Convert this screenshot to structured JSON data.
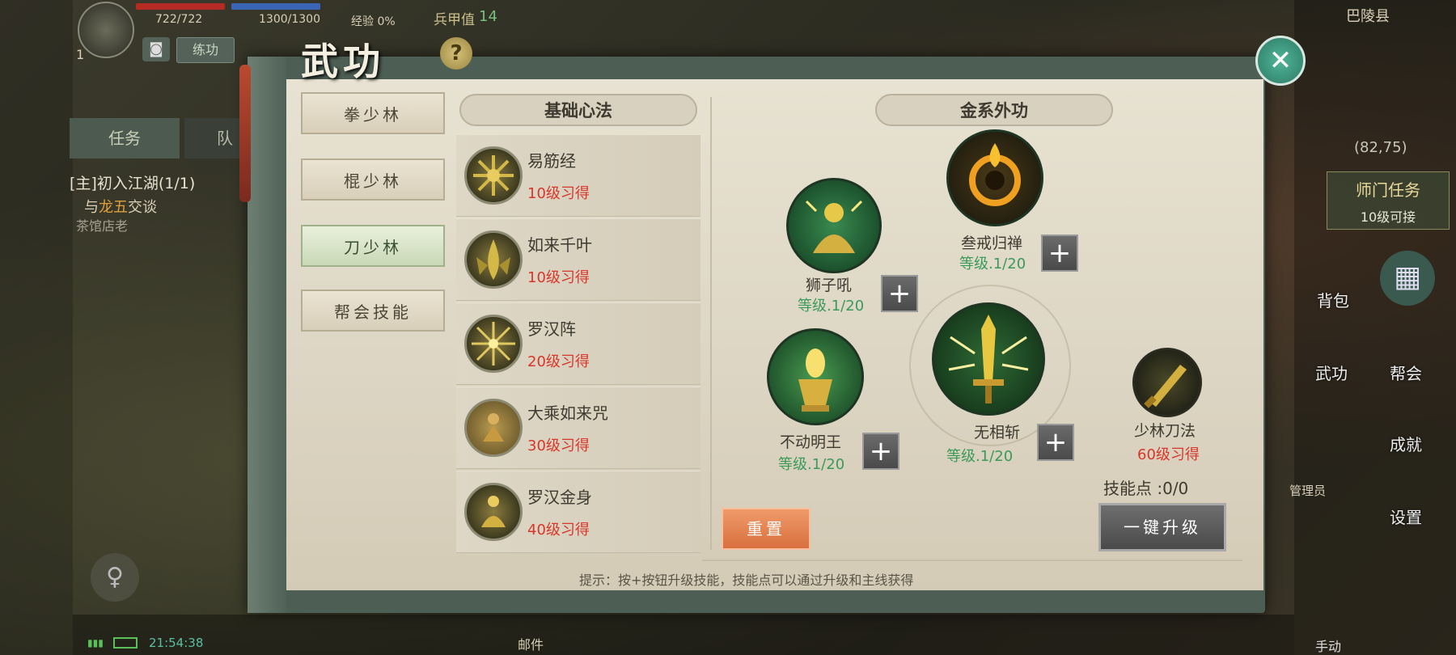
{
  "hud": {
    "hp": "722/722",
    "mp": "1300/1300",
    "exp": "经验 0%",
    "armor_label": "兵甲值",
    "armor_value": "14",
    "level": "1",
    "practice_btn": "练功",
    "task_tab": "任务",
    "team_tab": "队",
    "quest_title": "[主]初入江湖(1/1)",
    "quest_prefix": "与",
    "quest_npc": "龙五",
    "quest_action": "交谈",
    "quest_sub": "茶馆店老",
    "time": "21:54:38",
    "mail": "邮件"
  },
  "right_hud": {
    "location": "巴陵县",
    "coords": "(82,75)",
    "sect_task": "师门任务",
    "sect_task_req": "10级可接",
    "bag": "背包",
    "wugong": "武功",
    "guild": "帮会",
    "achievement": "成就",
    "settings": "设置",
    "admin": "管理员",
    "manual": "手动"
  },
  "modal": {
    "title": "武功",
    "help_symbol": "?",
    "close_symbol": "✕",
    "tabs": [
      {
        "label": "拳少林"
      },
      {
        "label": "棍少林"
      },
      {
        "label": "刀少林"
      },
      {
        "label": "帮会技能"
      }
    ],
    "active_tab": 2,
    "basic_title": "基础心法",
    "basic_list": [
      {
        "name": "易筋经",
        "req": "10级习得",
        "icon": "yijinjing-icon"
      },
      {
        "name": "如来千叶",
        "req": "10级习得",
        "icon": "rulai-qianye-icon"
      },
      {
        "name": "罗汉阵",
        "req": "20级习得",
        "icon": "luohan-zhen-icon"
      },
      {
        "name": "大乘如来咒",
        "req": "30级习得",
        "icon": "dacheng-icon"
      },
      {
        "name": "罗汉金身",
        "req": "40级习得",
        "icon": "luohan-jinshen-icon"
      }
    ],
    "ext_title": "金系外功",
    "skills": {
      "shizi": {
        "name": "狮子吼",
        "lv": "等级.1/20"
      },
      "sanjie": {
        "name": "叁戒归禅",
        "lv": "等级.1/20"
      },
      "budong": {
        "name": "不动明王",
        "lv": "等级.1/20"
      },
      "wuxiang": {
        "name": "无相斩",
        "lv": "等级.1/20"
      },
      "shaolin_dao": {
        "name": "少林刀法",
        "req": "60级习得"
      }
    },
    "plus_symbol": "+",
    "skill_points_label": "技能点 :0/0",
    "reset_btn": "重置",
    "upgrade_btn": "一键升级",
    "hint": "提示：按+按钮升级技能，技能点可以通过升级和主线获得"
  },
  "colors": {
    "green_level": "#3a9a5a",
    "red_req": "#d8362a",
    "reset_btn": "#e8845a",
    "close_btn": "#3e9d83"
  }
}
